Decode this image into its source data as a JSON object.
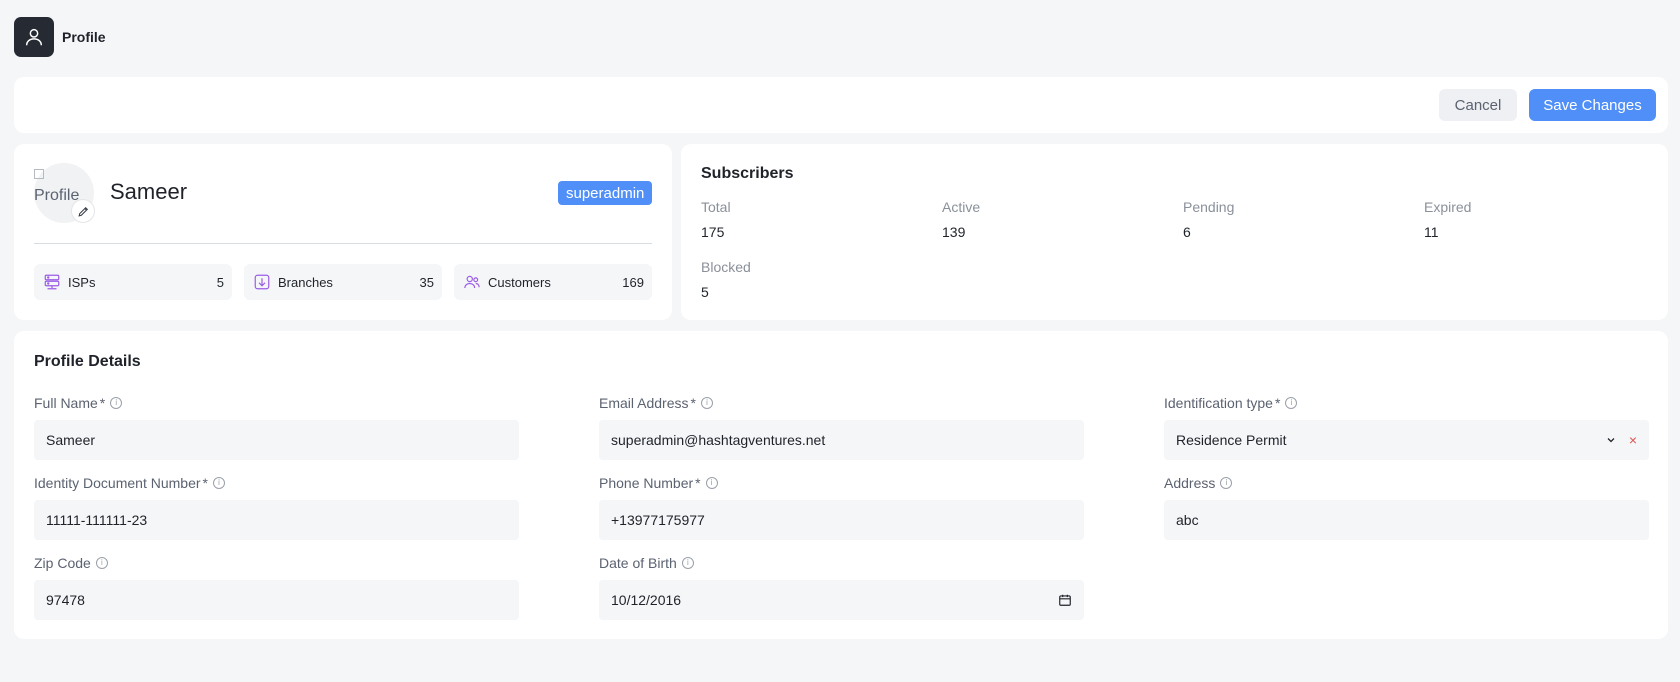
{
  "header": {
    "title": "Profile"
  },
  "actions": {
    "cancel": "Cancel",
    "save": "Save Changes"
  },
  "profile": {
    "image_alt": "Profile",
    "name": "Sameer",
    "role": "superadmin",
    "stats": [
      {
        "label": "ISPs",
        "value": "5",
        "icon": "server-icon"
      },
      {
        "label": "Branches",
        "value": "35",
        "icon": "branch-icon"
      },
      {
        "label": "Customers",
        "value": "169",
        "icon": "users-icon"
      }
    ]
  },
  "subscribers": {
    "title": "Subscribers",
    "items": [
      {
        "label": "Total",
        "value": "175"
      },
      {
        "label": "Active",
        "value": "139"
      },
      {
        "label": "Pending",
        "value": "6"
      },
      {
        "label": "Expired",
        "value": "11"
      },
      {
        "label": "Blocked",
        "value": "5"
      }
    ]
  },
  "details": {
    "title": "Profile Details",
    "fields": {
      "full_name": {
        "label": "Full Name",
        "required": "*",
        "value": "Sameer"
      },
      "email": {
        "label": "Email Address",
        "required": "*",
        "value": "superadmin@hashtagventures.net"
      },
      "id_type": {
        "label": "Identification type",
        "required": "*",
        "value": "Residence Permit",
        "clear": "×"
      },
      "id_number": {
        "label": "Identity Document Number",
        "required": "*",
        "value": "11111-111111-23"
      },
      "phone": {
        "label": "Phone Number",
        "required": "*",
        "value": "+13977175977"
      },
      "address": {
        "label": "Address",
        "value": "abc"
      },
      "zip": {
        "label": "Zip Code",
        "value": "97478"
      },
      "dob": {
        "label": "Date of Birth",
        "value": "10/12/2016"
      }
    }
  },
  "colors": {
    "accent": "#4f8ff7",
    "icon_purple": "#9b5de5",
    "clear_red": "#d9534f"
  }
}
